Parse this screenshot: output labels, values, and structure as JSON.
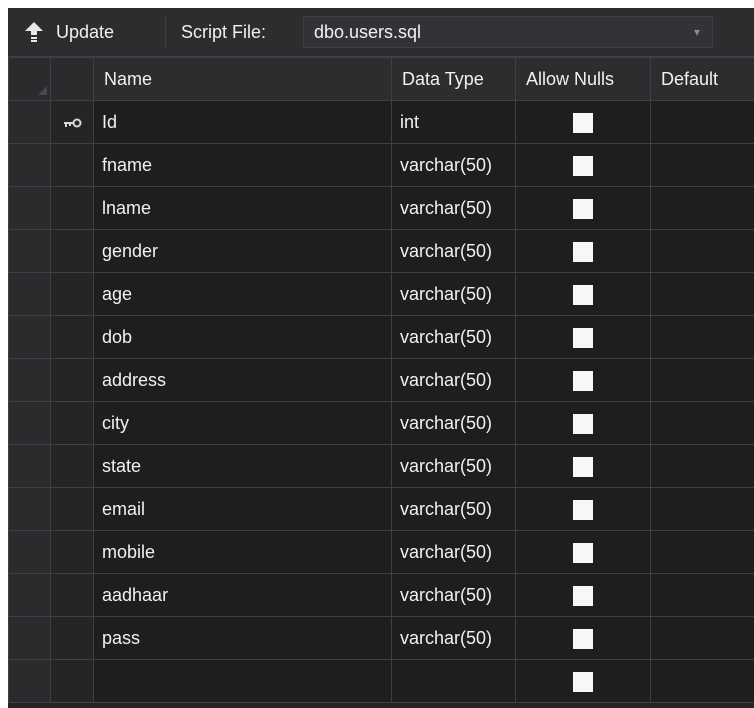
{
  "toolbar": {
    "update_label": "Update",
    "update_icon": "arrow-up-icon",
    "script_file_label": "Script File:",
    "script_file_value": "dbo.users.sql"
  },
  "grid": {
    "headers": {
      "name": "Name",
      "data_type": "Data Type",
      "allow_nulls": "Allow Nulls",
      "default": "Default"
    },
    "rows": [
      {
        "name": "Id",
        "data_type": "int",
        "allow_nulls": false,
        "primary_key": true
      },
      {
        "name": "fname",
        "data_type": "varchar(50)",
        "allow_nulls": false
      },
      {
        "name": "lname",
        "data_type": "varchar(50)",
        "allow_nulls": false
      },
      {
        "name": "gender",
        "data_type": "varchar(50)",
        "allow_nulls": false
      },
      {
        "name": "age",
        "data_type": "varchar(50)",
        "allow_nulls": false
      },
      {
        "name": "dob",
        "data_type": "varchar(50)",
        "allow_nulls": false
      },
      {
        "name": "address",
        "data_type": "varchar(50)",
        "allow_nulls": false
      },
      {
        "name": "city",
        "data_type": "varchar(50)",
        "allow_nulls": false
      },
      {
        "name": "state",
        "data_type": "varchar(50)",
        "allow_nulls": false
      },
      {
        "name": "email",
        "data_type": "varchar(50)",
        "allow_nulls": false
      },
      {
        "name": "mobile",
        "data_type": "varchar(50)",
        "allow_nulls": false
      },
      {
        "name": "aadhaar",
        "data_type": "varchar(50)",
        "allow_nulls": false
      },
      {
        "name": "pass",
        "data_type": "varchar(50)",
        "allow_nulls": false
      },
      {
        "name": "",
        "data_type": "",
        "allow_nulls": false
      }
    ]
  },
  "colors": {
    "background": "#1e1e1e",
    "toolbar": "#2d2d30",
    "grid_line": "#3f3f46",
    "text": "#f1f1f1",
    "checkbox": "#f7f7f7"
  }
}
